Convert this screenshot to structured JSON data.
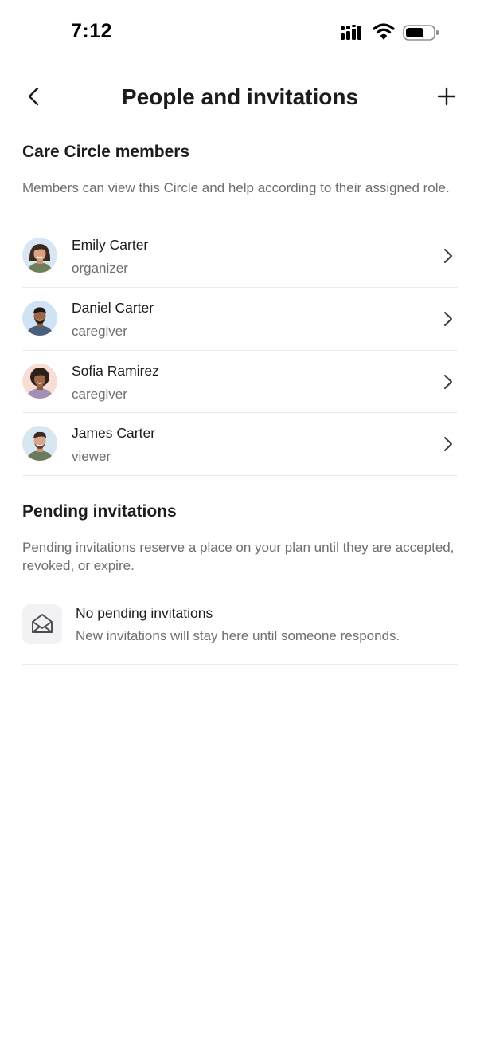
{
  "status_bar": {
    "time": "7:12"
  },
  "nav": {
    "title": "People and invitations"
  },
  "members_section": {
    "title": "Care Circle members",
    "description": "Members can view this Circle and help according to their assigned role.",
    "members": [
      {
        "name": "Emily Carter",
        "role": "organizer"
      },
      {
        "name": "Daniel Carter",
        "role": "caregiver"
      },
      {
        "name": "Sofia Ramirez",
        "role": "caregiver"
      },
      {
        "name": "James Carter",
        "role": "viewer"
      }
    ]
  },
  "pending_section": {
    "title": "Pending invitations",
    "description": "Pending invitations reserve a place on your plan until they are accepted, revoked, or expire.",
    "empty_title": "No pending invitations",
    "empty_subtitle": "New invitations will stay here until someone responds."
  },
  "icons": {
    "back": "chevron-left-icon",
    "add": "plus-icon",
    "row_chevron": "chevron-right-icon",
    "empty": "open-envelope-icon"
  },
  "colors": {
    "primary_text": "#1c1c1e",
    "secondary_text": "#6e6e73",
    "divider": "#ebebed",
    "icon_bg": "#f2f2f4"
  }
}
